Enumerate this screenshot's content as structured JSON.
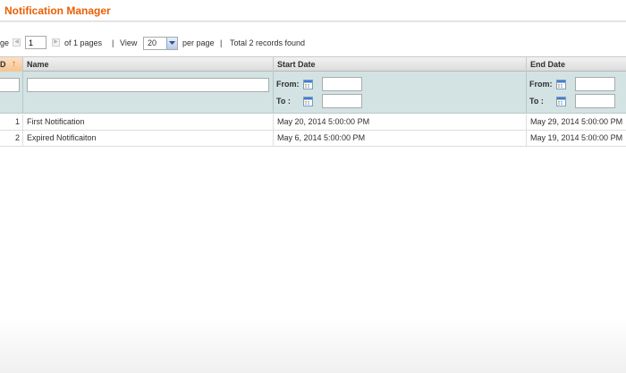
{
  "page": {
    "title": "Notification Manager"
  },
  "pager": {
    "page_label": "ge",
    "page_value": "1",
    "of_pages": "of 1 pages",
    "sep1": "|",
    "view_label": "View",
    "per_page_value": "20",
    "per_page_label": "per page",
    "sep2": "|",
    "total": "Total 2 records found",
    "prev_icon": "chevron-left-icon",
    "next_icon": "chevron-right-icon"
  },
  "grid": {
    "columns": {
      "id": "D",
      "name": "Name",
      "start_date": "Start Date",
      "end_date": "End Date"
    },
    "sort_icon": "arrow-up-icon",
    "filters": {
      "from_label": "From:",
      "to_label": "To :"
    },
    "rows": [
      {
        "id": "1",
        "name": "First Notification",
        "start_date": "May 20, 2014 5:00:00 PM",
        "end_date": "May 29, 2014 5:00:00 PM"
      },
      {
        "id": "2",
        "name": "Expired Notificaiton",
        "start_date": "May 6, 2014 5:00:00 PM",
        "end_date": "May 19, 2014 5:00:00 PM"
      }
    ]
  },
  "colors": {
    "accent": "#eb5e00",
    "filter_bg": "#d3e3e4",
    "sorted_header": "#f5c28f"
  }
}
